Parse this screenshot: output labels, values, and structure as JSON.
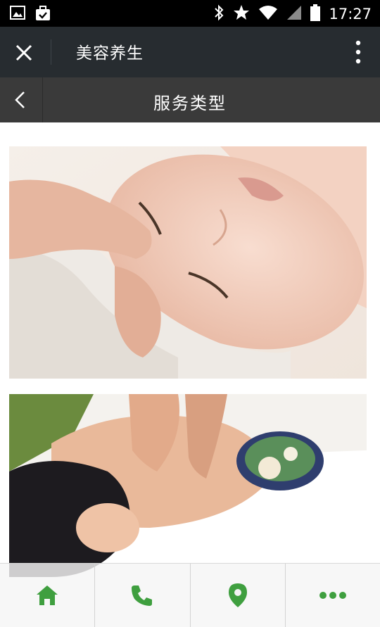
{
  "status_bar": {
    "left_icons": [
      "image-icon",
      "briefcase-check-icon"
    ],
    "right_icons": [
      "bluetooth-icon",
      "star-icon",
      "wifi-icon",
      "signal-icon",
      "battery-icon"
    ],
    "time": "17:27"
  },
  "title_bar": {
    "title": "美容养生",
    "close_icon": "close-icon",
    "more_icon": "more-vertical-icon"
  },
  "page_header": {
    "title": "服务类型",
    "back_icon": "chevron-left-icon"
  },
  "content": {
    "images": [
      "facial-massage-photo",
      "back-massage-photo"
    ]
  },
  "bottom_nav": {
    "items": [
      {
        "icon": "home-icon"
      },
      {
        "icon": "phone-icon"
      },
      {
        "icon": "location-pin-icon"
      },
      {
        "icon": "more-horizontal-icon"
      }
    ],
    "accent_color": "#3f9f3f"
  },
  "colors": {
    "status_bar": "#000000",
    "title_bar": "#272c30",
    "page_header": "#3a3a3a"
  }
}
